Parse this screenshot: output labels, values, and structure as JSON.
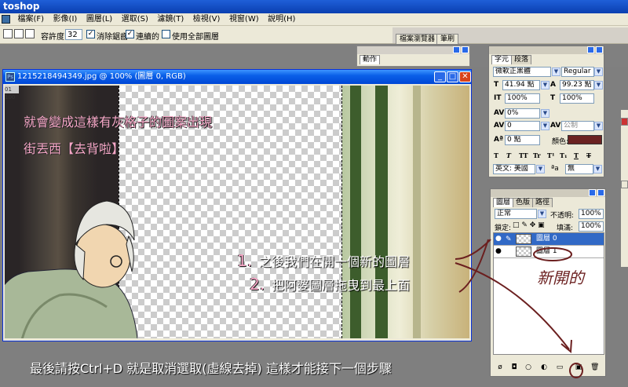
{
  "app": {
    "title": "toshop"
  },
  "menu": {
    "items": [
      "檔案(F)",
      "影像(I)",
      "圖層(L)",
      "選取(S)",
      "濾鏡(T)",
      "檢視(V)",
      "視窗(W)",
      "說明(H)"
    ]
  },
  "options": {
    "tolerance_label": "容許度:",
    "tolerance_value": "32",
    "antialias_label": "消除鋸齒",
    "contiguous_label": "連續的",
    "sample_all_label": "使用全部圖層",
    "check_mark": "✓"
  },
  "palette_well": {
    "tabs": [
      "檔案瀏覽器",
      "筆刷"
    ]
  },
  "document": {
    "title": "1215218494349.jpg @ 100% (圖層 0, RGB)",
    "zoom_tag": "01 100",
    "ps_icon": "Ps",
    "btn_min": "_",
    "btn_max": "□",
    "btn_close": "✕"
  },
  "captions": {
    "line1": "就會變成這樣有灰格子的圖案出現",
    "line2": "街丟西【去背啦】",
    "step1_num": "1.",
    "step1": "之後我們在開一個新的圖層",
    "step2_num": "2.",
    "step2": "把阿婆圖層拖曳到最上面",
    "bottom": "最後請按Ctrl+D  就是取消選取(虛線去掉)  這樣才能接下一個步驟",
    "scribble": "新開的"
  },
  "action_panel": {
    "tab": "動作"
  },
  "char_panel": {
    "tabs": [
      "字元",
      "段落"
    ],
    "font": "微軟正黑體",
    "style": "Regular",
    "size": "41.94 點",
    "leading": "99.23 點",
    "vscale": "100%",
    "hscale": "100%",
    "tracking": "0%",
    "kerning": "0",
    "kern_mode": "公制",
    "baseline": "0 點",
    "color_label": "顏色:",
    "color": "#6b2222",
    "lang": "英文: 美國",
    "aa_label": "ªa",
    "aa": "無",
    "size_icon": "T",
    "leading_icon": "A",
    "tracking_icon": "AV",
    "baseline_icon": "Aª",
    "styles": [
      "T",
      "T",
      "TT",
      "Tr",
      "T¹",
      "T₁",
      "T",
      "T"
    ]
  },
  "layers_panel": {
    "tabs": [
      "圖層",
      "色版",
      "路徑"
    ],
    "blend_mode": "正常",
    "opacity_label": "不透明:",
    "opacity": "100%",
    "lock_label": "鎖定:",
    "fill_label": "填滿:",
    "fill": "100%",
    "layers": [
      {
        "name": "圖層 0",
        "selected": true
      },
      {
        "name": "圖層 1",
        "selected": false
      }
    ],
    "eye_glyph": "●",
    "footer_icons": [
      "ø",
      "◘",
      "○",
      "◐",
      "▭",
      "▣",
      "🗑"
    ]
  },
  "colors": {
    "accent": "#0a5fe8",
    "selection": "#3169c6",
    "brush": "#6b1f1f"
  }
}
